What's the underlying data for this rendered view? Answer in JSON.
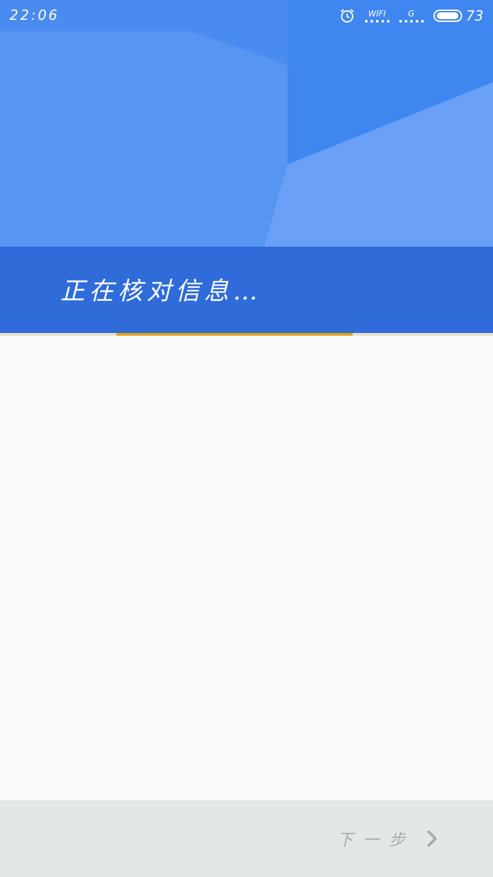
{
  "status_bar": {
    "time": "22:06",
    "wifi_label": "WIFI",
    "cell_label": "G",
    "battery_level": "73",
    "battery_fraction": 0.73
  },
  "banner": {
    "message": "正在核对信息…"
  },
  "progress": {
    "start_fraction": 0.236,
    "end_fraction": 0.715
  },
  "footer": {
    "next_label": "下一步",
    "next_icon": "chevron-right-icon"
  },
  "colors": {
    "hero": "#4a8bef",
    "banner": "#2f6bd9",
    "progress": "#e0a218",
    "footer_bg": "#e4e7e8",
    "footer_text": "#a9adb0"
  }
}
